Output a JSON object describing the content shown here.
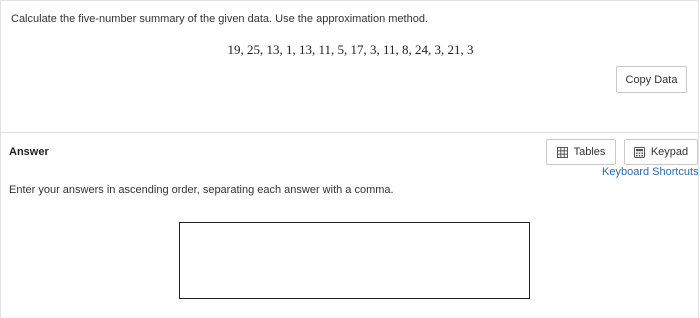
{
  "question": {
    "prompt": "Calculate the five-number summary of the given data. Use the approximation method.",
    "dataset": "19, 25, 13, 1, 13, 11, 5, 17, 3, 11, 8, 24, 3, 21, 3",
    "copy_button_label": "Copy Data"
  },
  "answer": {
    "heading": "Answer",
    "tables_label": "Tables",
    "keypad_label": "Keypad",
    "shortcuts_label": "Keyboard Shortcuts",
    "instructions": "Enter your answers in ascending order, separating each answer with a comma.",
    "input_value": ""
  },
  "icons": {
    "tables": "table-grid-icon",
    "keypad": "calculator-icon"
  },
  "colors": {
    "link": "#2b6ab1",
    "border": "#c9c9c9",
    "text": "#333333"
  }
}
